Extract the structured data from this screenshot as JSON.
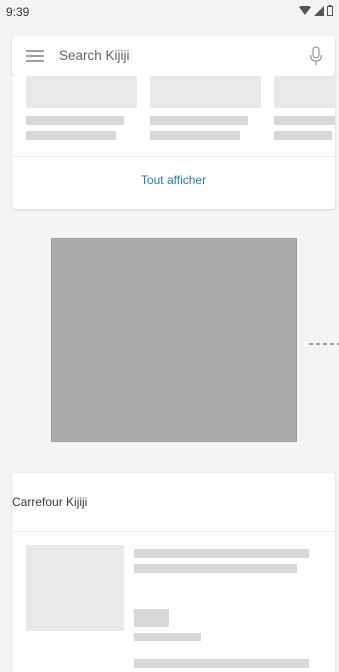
{
  "status_bar": {
    "time": "9:39"
  },
  "search": {
    "placeholder": "Search Kijiji"
  },
  "top_section": {
    "view_all_label": "Tout afficher"
  },
  "carrefour": {
    "title": "Carrefour Kijiji"
  },
  "colors": {
    "accent": "#1a7fc1",
    "background": "#f4f4f5",
    "placeholder": "#e9e9ea",
    "ad_block": "#ababab"
  }
}
